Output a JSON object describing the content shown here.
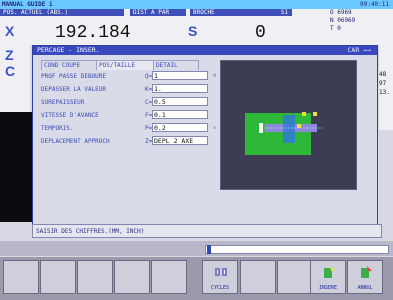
{
  "header": {
    "mode": "MANUAL GUIDE i",
    "time": "09:40:11",
    "pos_title": "POS. ACTUEL (ABS.)",
    "dist_title": "DIST A PAR",
    "spindle_title": "BROCHE",
    "spindle_id": "S1",
    "axis_x": "X",
    "x_value": "192.184",
    "axis_s": "S",
    "s_value": "0",
    "readout_o": "O 6969",
    "readout_n": "N 06969",
    "readout_t": "T 0"
  },
  "left_axes": {
    "z": "Z",
    "c": "C"
  },
  "right_values": [
    "48",
    "97",
    "13."
  ],
  "dialog": {
    "title": "PERCAGE - INSER.",
    "title_right": "CAR →→",
    "tabs": [
      "COND COUPE",
      "POS/TAILLE",
      "DETAIL"
    ],
    "fields": [
      {
        "label": "PROF PASSE DEBOURE",
        "key": "Q=",
        "value": "1",
        "unit": "d"
      },
      {
        "label": "DEPASSER LA VALEUR",
        "key": "K=",
        "value": "1.",
        "unit": ""
      },
      {
        "label": "SUREPAISSEUR",
        "key": "C=",
        "value": "0.5",
        "unit": ""
      },
      {
        "label": "VITESSE D'AVANCE",
        "key": "F=",
        "value": "0.1",
        "unit": ""
      },
      {
        "label": "TEMPORIS.",
        "key": "P=",
        "value": "0.2",
        "unit": "s"
      },
      {
        "label": "DEPLACEMENT APPROCH",
        "key": "Z=",
        "value": "DEPL 2 AXE",
        "unit": ""
      }
    ],
    "status": "SAISIR DES CHIFFRES.(MM, INCH)"
  },
  "softkeys": {
    "cycles_label": "CYCLES",
    "insert_label": "INSERE",
    "cancel_label": "ANNUL"
  },
  "colors": {
    "accent": "#3a48c0",
    "part_green": "#2fb838",
    "tool_yellow": "#e6e040"
  }
}
